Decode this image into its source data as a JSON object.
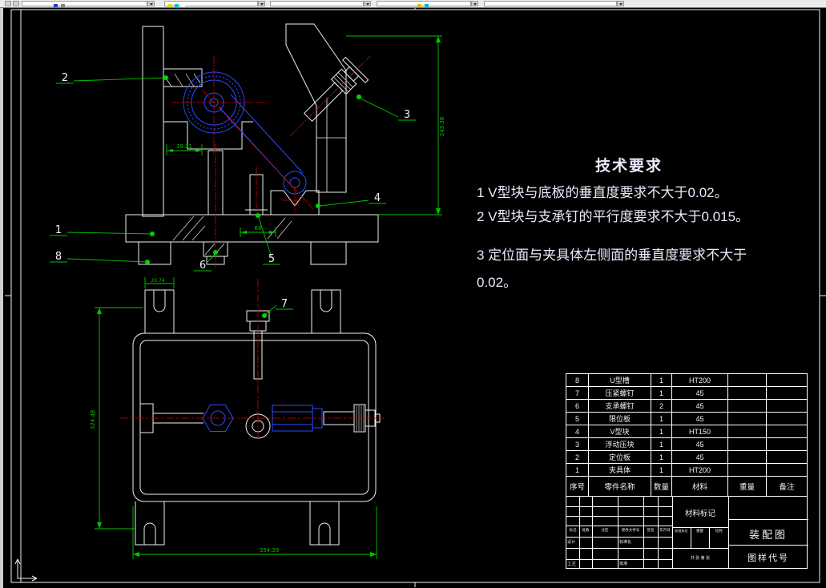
{
  "colors": {
    "background": "#000000",
    "line_white": "#f0f0f0",
    "dimension_green": "#00c400",
    "centerline_red": "#d40000",
    "detail_blue": "#2e4bff"
  },
  "toolbar": {
    "icons": [
      "layer-toggle-icon",
      "layer-dropdown",
      "color-dropdown",
      "linetype-dropdown",
      "lineweight-dropdown",
      "plotstyle-dropdown"
    ]
  },
  "tech_requirements": {
    "title": "技术要求",
    "line1": "1  V型块与底板的垂直度要求不大于0.02。",
    "line2": "2  V型块与支承钉的平行度要求不大于0.015。",
    "line3": "3  定位面与夹具体左侧面的垂直度要求不大于",
    "line4": "0.02。"
  },
  "drawing": {
    "balloons": {
      "b1": "1",
      "b2": "2",
      "b3": "3",
      "b4": "4",
      "b5": "5",
      "b6": "6",
      "b7": "7",
      "b8": "8"
    },
    "dims": {
      "front_height": "243.38",
      "front_offset": "39.21",
      "front_span": "68",
      "top_height": "324.48",
      "top_width": "354.39",
      "top_tab": "20.74"
    }
  },
  "bom": {
    "headers": [
      "序号",
      "零件名称",
      "数量",
      "材料",
      "重量",
      "备注"
    ],
    "rows": [
      {
        "no": "8",
        "name": "U型槽",
        "qty": "1",
        "mat": "HT200"
      },
      {
        "no": "7",
        "name": "压紧螺钉",
        "qty": "1",
        "mat": "45"
      },
      {
        "no": "6",
        "name": "支承螺钉",
        "qty": "2",
        "mat": "45"
      },
      {
        "no": "5",
        "name": "限位板",
        "qty": "1",
        "mat": "45"
      },
      {
        "no": "4",
        "name": "V型块",
        "qty": "1",
        "mat": "HT150"
      },
      {
        "no": "3",
        "name": "浮动压块",
        "qty": "1",
        "mat": "45"
      },
      {
        "no": "2",
        "name": "定位板",
        "qty": "1",
        "mat": "45"
      },
      {
        "no": "1",
        "name": "夹具体",
        "qty": "1",
        "mat": "HT200"
      }
    ]
  },
  "title_block": {
    "material_mark": "材料标记",
    "drawing_title": "装配图",
    "drawing_code": "图样代号",
    "revision_labels": [
      "标记",
      "处数",
      "分区",
      "更改文件号",
      "签名",
      "年月日"
    ],
    "role_labels": [
      "设计",
      "标准化",
      "工艺",
      "批准"
    ],
    "stage_labels": [
      "阶段标记",
      "重量",
      "比例"
    ],
    "sheet_label": "共 张 第 张"
  }
}
